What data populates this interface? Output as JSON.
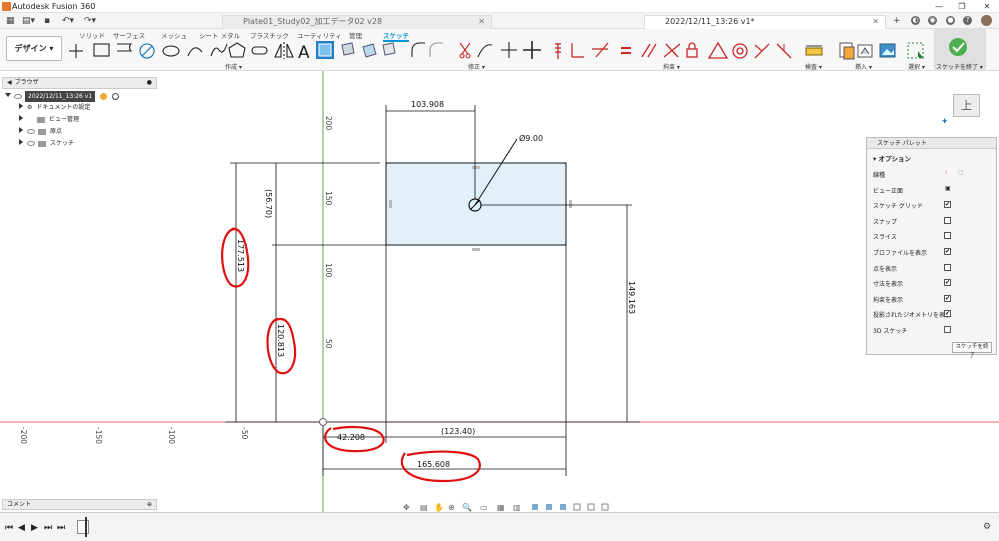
{
  "app": {
    "title": "Autodesk Fusion 360"
  },
  "tabs": [
    {
      "label": "Plate01_Study02_加工データ02 v28",
      "active": false
    },
    {
      "label": "2022/12/11_13:26 v1*",
      "active": true
    }
  ],
  "toolbar": {
    "workspace_label": "デザイン ▾",
    "ribbon_tabs": [
      "ソリッド",
      "サーフェス",
      "メッシュ",
      "シート メタル",
      "プラスチック",
      "ユーティリティ",
      "管理",
      "スケッチ"
    ],
    "groups": {
      "create": "作成 ▾",
      "modify": "修正 ▾",
      "constraints": "拘束 ▾",
      "inspect": "検査 ▾",
      "insert": "挿入 ▾",
      "select": "選択 ▾",
      "finish": "スケッチを終了 ▾"
    }
  },
  "browser": {
    "title": "ブラウザ",
    "root": "2022/12/11_13:26 v1",
    "items": [
      "ドキュメントの設定",
      "ビュー管理",
      "原点",
      "スケッチ"
    ]
  },
  "comment": {
    "label": "コメント"
  },
  "palette": {
    "title": "スケッチ パレット",
    "section": "オプション",
    "rows": [
      {
        "label": "線種",
        "type": "icon"
      },
      {
        "label": "ビュー正面",
        "type": "icon"
      },
      {
        "label": "スケッチ グリッド",
        "checked": true
      },
      {
        "label": "スナップ",
        "checked": false
      },
      {
        "label": "スライス",
        "checked": false
      },
      {
        "label": "プロファイルを表示",
        "checked": true
      },
      {
        "label": "点を表示",
        "checked": false
      },
      {
        "label": "寸法を表示",
        "checked": true
      },
      {
        "label": "拘束を表示",
        "checked": true
      },
      {
        "label": "投影されたジオメトリを表示",
        "checked": true
      },
      {
        "label": "3D スケッチ",
        "checked": false
      }
    ],
    "finish_button": "スケッチを終了"
  },
  "viewcube": {
    "face": "上"
  },
  "dimensions": {
    "top_width": "103.908",
    "diameter": "Ø9.00",
    "ref_width": "(123.40)",
    "x_offset": "42.208",
    "total_width": "165.608",
    "right_height": "149.163",
    "ref_height": "(56.70)",
    "left_height": "177.513",
    "mid_height": "120.813"
  },
  "axis": {
    "y_ticks": [
      "200",
      "150",
      "100",
      "50"
    ],
    "x_ticks": [
      "-200",
      "-150",
      "-100",
      "-50"
    ]
  },
  "colors": {
    "accent": "#0696d7",
    "x_axis": "#e05050",
    "y_axis": "#4caf50",
    "annotation": "#e01010",
    "profile_fill": "#e1f0fa"
  }
}
